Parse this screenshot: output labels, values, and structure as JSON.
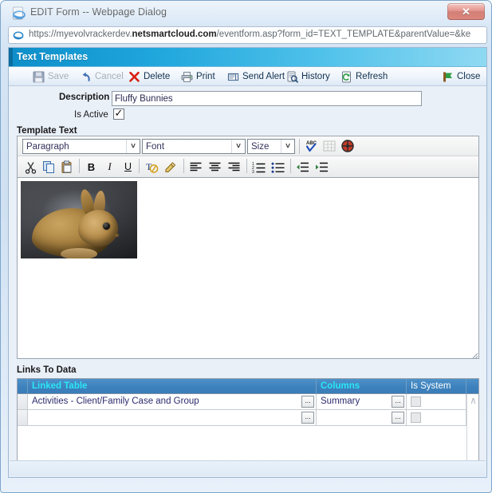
{
  "window": {
    "title": "EDIT Form -- Webpage Dialog",
    "close_label": "✕",
    "icon": "internet-explorer-icon"
  },
  "address": {
    "url_prefix": "https://myevolvrackerdev.",
    "url_domain": "netsmartcloud.com",
    "url_suffix": "/eventform.asp?form_id=TEXT_TEMPLATE&parentValue=&ke",
    "icon": "page-link-icon"
  },
  "page_header": {
    "title": "Text Templates"
  },
  "toolbar": {
    "buttons": [
      {
        "label": "Save",
        "icon": "floppy-disk-icon",
        "disabled": true
      },
      {
        "label": "Cancel",
        "icon": "undo-arrow-icon",
        "disabled": true
      },
      {
        "label": "Delete",
        "icon": "red-x-icon",
        "disabled": false
      },
      {
        "label": "Print",
        "icon": "printer-icon",
        "disabled": false
      },
      {
        "label": "Send Alert",
        "icon": "envelope-icon",
        "disabled": false
      },
      {
        "label": "History",
        "icon": "history-icon",
        "disabled": false
      },
      {
        "label": "Refresh",
        "icon": "refresh-icon",
        "disabled": false
      },
      {
        "label": "Close",
        "icon": "exit-door-icon",
        "disabled": false
      }
    ]
  },
  "form": {
    "description_label": "Description",
    "description_value": "Fluffy Bunnies",
    "description_placeholder": "",
    "is_active_label": "Is Active",
    "is_active_checked": true,
    "is_active_check_glyph": "✓",
    "template_text_label": "Template Text"
  },
  "editor": {
    "dropdowns": [
      {
        "name": "paragraph",
        "value": "Paragraph"
      },
      {
        "name": "font",
        "value": "Font"
      },
      {
        "name": "size",
        "value": "Size"
      }
    ],
    "arrow_glyph": "˅",
    "row1_tools": [
      {
        "name": "spell-check-icon",
        "disabled": false
      },
      {
        "name": "insert-table-icon",
        "disabled": true
      },
      {
        "name": "insert-datetime-icon",
        "disabled": false
      }
    ],
    "row2_tools": [
      {
        "name": "cut-icon"
      },
      {
        "name": "copy-icon"
      },
      {
        "name": "paste-icon"
      },
      {
        "name": "bold-icon"
      },
      {
        "name": "italic-icon"
      },
      {
        "name": "underline-icon"
      },
      {
        "name": "font-color-icon"
      },
      {
        "name": "highlight-color-icon"
      },
      {
        "name": "align-left-icon"
      },
      {
        "name": "align-center-icon"
      },
      {
        "name": "align-right-icon"
      },
      {
        "name": "ordered-list-icon"
      },
      {
        "name": "unordered-list-icon"
      },
      {
        "name": "outdent-icon"
      },
      {
        "name": "indent-icon"
      }
    ],
    "content_image_alt": "rabbit-photo"
  },
  "links_to_data": {
    "section_label": "Links To Data",
    "columns": [
      "Linked Table",
      "Columns",
      "Is System"
    ],
    "rows": [
      {
        "linked_table": "Activities - Client/Family Case and Group",
        "columns": "Summary",
        "is_system": false
      },
      {
        "linked_table": "",
        "columns": "",
        "is_system": false
      }
    ],
    "ellipsis_label": "...",
    "scroll_up_glyph": "∧",
    "scroll_down_glyph": "∨"
  },
  "colors": {
    "header_blue_dark": "#0d8ec9",
    "header_blue_light": "#8fd9f2",
    "grid_header_blue": "#3d82bd",
    "grid_header_cyan_text": "#2ce6f5",
    "close_red": "#bb3d30",
    "link_text": "#2b2b6e"
  }
}
